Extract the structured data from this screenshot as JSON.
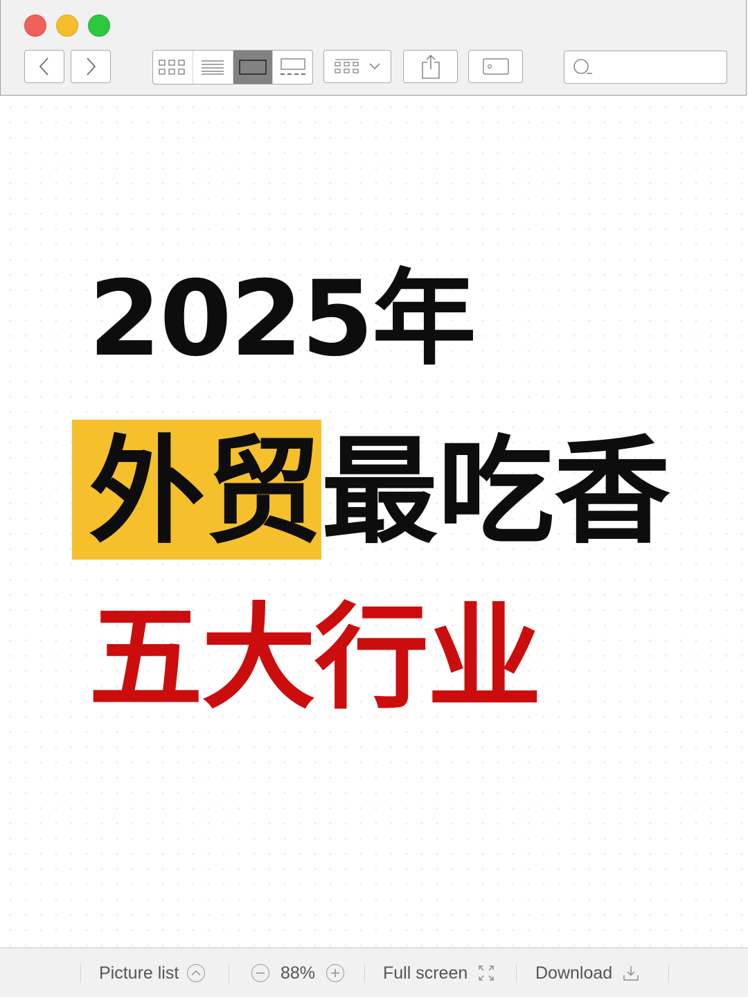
{
  "window": {
    "controls": [
      "close",
      "minimize",
      "zoom"
    ]
  },
  "toolbar": {
    "nav": [
      "chevron-left-icon",
      "chevron-right-icon"
    ],
    "view_modes": [
      "grid-view-icon",
      "list-view-icon",
      "single-view-icon",
      "filmstrip-view-icon"
    ],
    "active_view": "single-view",
    "group_menu_icon": "group-grid-icon",
    "share_icon": "share-icon",
    "tag_icon": "tag-icon",
    "search": {
      "placeholder": "",
      "value": ""
    }
  },
  "content": {
    "year_line": "2025年",
    "highlight_text": "外贸",
    "line2_rest": "最吃香",
    "line3": "五大行业",
    "colors": {
      "highlight": "#f5c02c",
      "black_text": "#0d0d0d",
      "red_text": "#cc0d0d"
    }
  },
  "bottom_bar": {
    "picture_list": "Picture list",
    "zoom": "88%",
    "full_screen": "Full screen",
    "download": "Download"
  }
}
